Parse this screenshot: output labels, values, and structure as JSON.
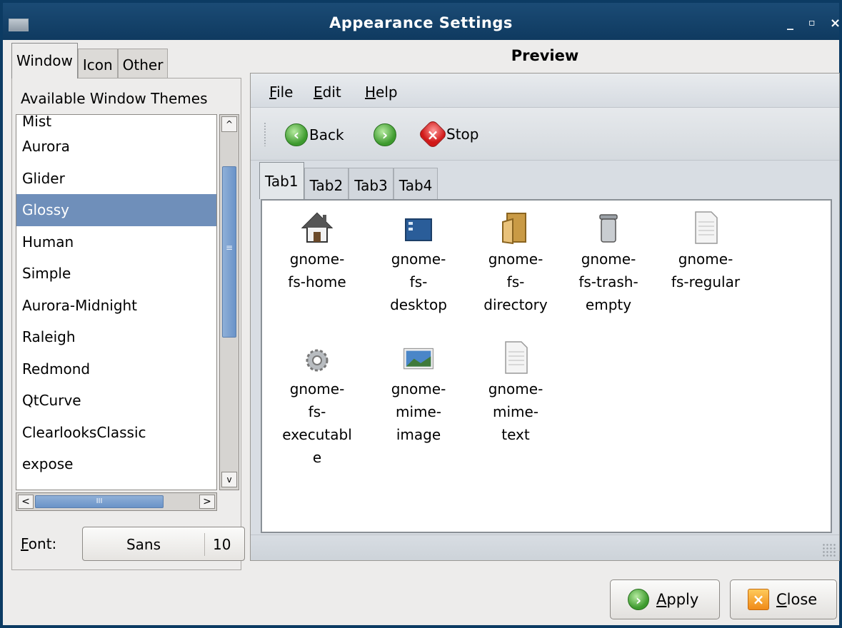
{
  "window": {
    "title": "Appearance Settings",
    "controls": [
      "_",
      "▫",
      "×"
    ]
  },
  "left_tabs": [
    {
      "label": "Window",
      "active": true
    },
    {
      "label": "Icon",
      "active": false
    },
    {
      "label": "Other",
      "active": false
    }
  ],
  "themes": {
    "heading": "Available Window Themes",
    "items": [
      "Mist",
      "Aurora",
      "Glider",
      "Glossy",
      "Human",
      "Simple",
      "Aurora-Midnight",
      "Raleigh",
      "Redmond",
      "QtCurve",
      "ClearlooksClassic",
      "expose"
    ],
    "selected": "Glossy"
  },
  "scrollbars": {
    "hthumb_marker": "III",
    "vthumb_marker": "≡",
    "up": "^",
    "down": "v",
    "left": "<",
    "right": ">"
  },
  "font": {
    "label_prefix": "F",
    "label_rest": "ont:",
    "name": "Sans",
    "size": "10"
  },
  "preview": {
    "title": "Preview",
    "menu": [
      {
        "ul": "F",
        "rest": "ile"
      },
      {
        "ul": "E",
        "rest": "dit"
      },
      {
        "ul": "H",
        "rest": "elp"
      }
    ],
    "toolbar": {
      "back": "Back",
      "stop": "Stop"
    },
    "tabs": [
      {
        "label": "Tab1",
        "active": true
      },
      {
        "label": "Tab2",
        "active": false
      },
      {
        "label": "Tab3",
        "active": false
      },
      {
        "label": "Tab4",
        "active": false
      }
    ],
    "icons": [
      {
        "name": "home-icon",
        "lines": [
          "gnome-",
          "fs-home"
        ]
      },
      {
        "name": "desktop-icon",
        "lines": [
          "gnome-",
          "fs-",
          "desktop"
        ]
      },
      {
        "name": "folder-icon",
        "lines": [
          "gnome-",
          "fs-",
          "directory"
        ]
      },
      {
        "name": "trash-icon",
        "lines": [
          "gnome-",
          "fs-trash-",
          "empty"
        ]
      },
      {
        "name": "document-icon",
        "lines": [
          "gnome-",
          "fs-regular"
        ]
      },
      {
        "name": "gear-icon",
        "lines": [
          "gnome-",
          "fs-",
          "executabl",
          "e"
        ]
      },
      {
        "name": "image-icon",
        "lines": [
          "gnome-",
          "mime-",
          "image"
        ]
      },
      {
        "name": "text-icon",
        "lines": [
          "gnome-",
          "mime-",
          "text"
        ]
      }
    ]
  },
  "buttons": {
    "apply": {
      "ul": "A",
      "rest": "pply"
    },
    "close": {
      "ul": "C",
      "rest": "lose"
    }
  }
}
